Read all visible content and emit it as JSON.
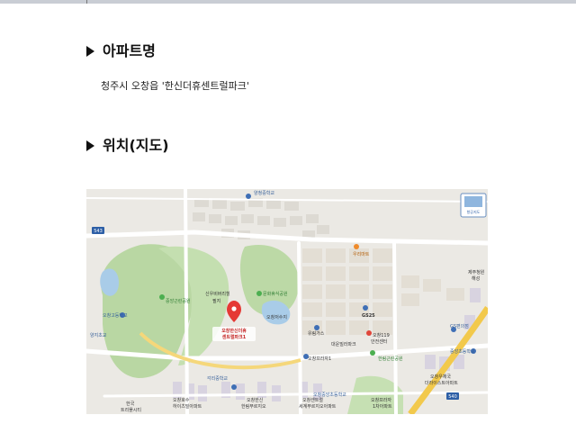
{
  "sections": [
    {
      "heading": "아파트명",
      "body": "청주시 오창읍 '한신더휴센트럴파크'"
    },
    {
      "heading": "위치(지도)"
    }
  ],
  "map": {
    "view_button": "항공지도",
    "road_labels": {
      "route_a": "543",
      "route_b": "540"
    },
    "marker_label_line1": "오창한신더휴",
    "marker_label_line2": "센트럴파크1",
    "places": {
      "p01": "양청중학교",
      "p02": "중앙근린공원",
      "p03": "신우비버리힐",
      "p04": "필지",
      "p05": "문화휴식공원",
      "p06": "오창저수지",
      "p07": "오창고등학교",
      "p08": "양지초교",
      "p09": "우리마트",
      "p10": "GS25",
      "p11": "유림가스",
      "p12": "대운빌라파크",
      "p13": "오창119",
      "p14": "안전센터",
      "p15": "오창프라자1",
      "p16": "한림근린공원",
      "p17": "오창중앙초등학교",
      "p18": "제주청원",
      "p19": "해성",
      "p20": "GS편의점",
      "p21": "중앙초등학교",
      "p22": "오창우체국",
      "p23": "더라이스트아파트",
      "p24": "각리중학교",
      "p25": "오창호수",
      "p26": "하이츠빌아파트",
      "p27": "오창한신",
      "p28": "한림푸르지오",
      "p29": "오창센트럴",
      "p30": "세계푸르지오아파트",
      "p31": "한국",
      "p32": "트리플시티",
      "p33": "오창프라자",
      "p34": "1차아파트"
    }
  }
}
